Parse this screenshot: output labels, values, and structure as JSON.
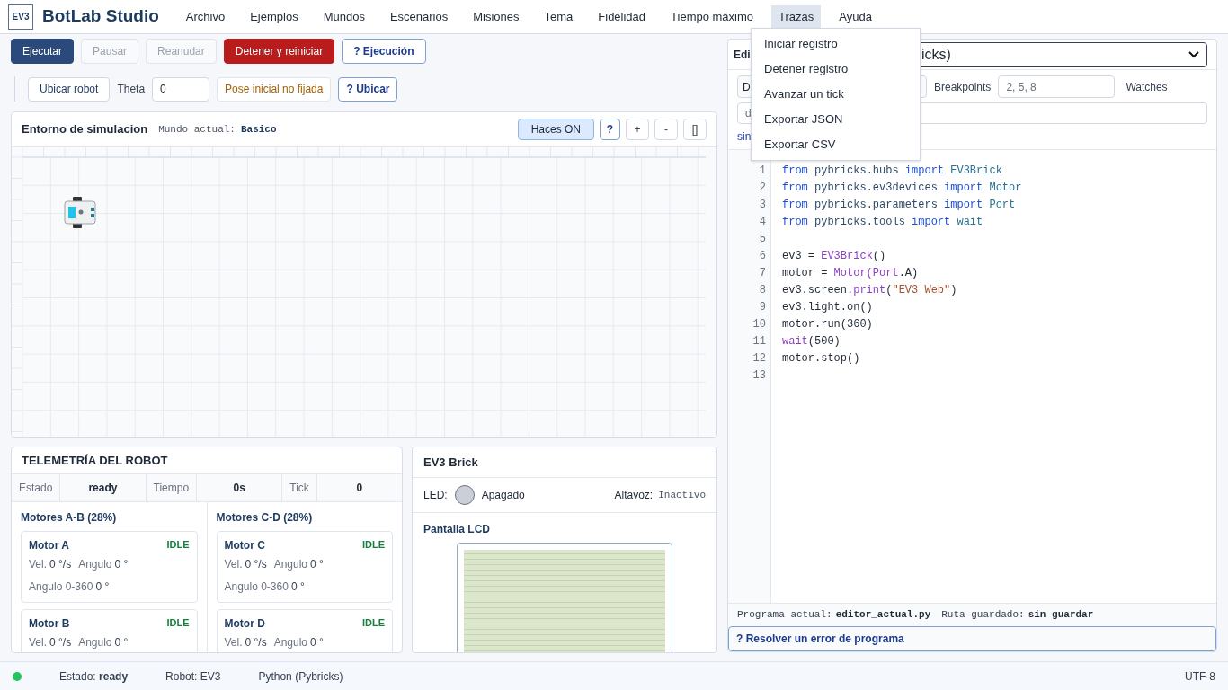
{
  "app": {
    "logo": "EV3",
    "title": "BotLab Studio"
  },
  "menu_bar": [
    {
      "label": "Archivo",
      "selected": false
    },
    {
      "label": "Ejemplos",
      "selected": false
    },
    {
      "label": "Mundos",
      "selected": false
    },
    {
      "label": "Escenarios",
      "selected": false
    },
    {
      "label": "Misiones",
      "selected": false
    },
    {
      "label": "Tema",
      "selected": false
    },
    {
      "label": "Fidelidad",
      "selected": false
    },
    {
      "label": "Tiempo máximo",
      "selected": false
    },
    {
      "label": "Trazas",
      "selected": true
    },
    {
      "label": "Ayuda",
      "selected": false
    }
  ],
  "open_menu": {
    "items": [
      "Iniciar registro",
      "Detener registro",
      "Avanzar un tick",
      "Exportar JSON",
      "Exportar CSV"
    ]
  },
  "run_toolbar": [
    {
      "label": "Ejecutar",
      "kind": "primary"
    },
    {
      "label": "Pausar",
      "kind": "disabled"
    },
    {
      "label": "Reanudar",
      "kind": "disabled"
    },
    {
      "label": "Detener y reiniciar",
      "kind": "danger"
    },
    {
      "label": "? Ejecución",
      "kind": "help"
    }
  ],
  "place_toolbar": {
    "place_button": "Ubicar robot",
    "theta_label": "Theta",
    "theta_value": "0",
    "pose_status": "Pose inicial no fijada",
    "help_button": "? Ubicar"
  },
  "simulation": {
    "title": "Entorno de simulacion",
    "world_label": "Mundo actual:",
    "world": "Basico",
    "controls": [
      {
        "label": "Haces ON",
        "kind": "toggle",
        "on": true
      },
      {
        "label": "?",
        "kind": "help"
      },
      {
        "label": "+",
        "kind": "plain"
      },
      {
        "label": "-",
        "kind": "plain"
      },
      {
        "label": "[]",
        "kind": "plain"
      }
    ]
  },
  "telemetry": {
    "title": "TELEMETRÍA DEL ROBOT",
    "stats": [
      {
        "label": "Estado",
        "value": "ready"
      },
      {
        "label": "Tiempo",
        "value": "0s"
      },
      {
        "label": "Tick",
        "value": "0"
      }
    ],
    "groups": [
      {
        "title": "Motores A-B (28%)",
        "motors": [
          {
            "name": "Motor A",
            "status": "IDLE",
            "rows": [
              [
                {
                  "label": "Vel.",
                  "value": "0 °/s"
                },
                {
                  "label": "Angulo",
                  "value": "0 °"
                }
              ],
              [
                {
                  "label": "Angulo 0-360",
                  "value": "0 °"
                }
              ]
            ]
          },
          {
            "name": "Motor B",
            "status": "IDLE",
            "rows": [
              [
                {
                  "label": "Vel.",
                  "value": "0 °/s"
                },
                {
                  "label": "Angulo",
                  "value": "0 °"
                }
              ]
            ]
          }
        ]
      },
      {
        "title": "Motores C-D (28%)",
        "motors": [
          {
            "name": "Motor C",
            "status": "IDLE",
            "rows": [
              [
                {
                  "label": "Vel.",
                  "value": "0 °/s"
                },
                {
                  "label": "Angulo",
                  "value": "0 °"
                }
              ],
              [
                {
                  "label": "Angulo 0-360",
                  "value": "0 °"
                }
              ]
            ]
          },
          {
            "name": "Motor D",
            "status": "IDLE",
            "rows": [
              [
                {
                  "label": "Vel.",
                  "value": "0 °/s"
                },
                {
                  "label": "Angulo",
                  "value": "0 °"
                }
              ]
            ]
          }
        ]
      }
    ]
  },
  "brick": {
    "title": "EV3 Brick",
    "led_label": "LED:",
    "led_on": false,
    "led_state": "Apagado",
    "speaker_label": "Altavoz:",
    "speaker_state": "Inactivo",
    "lcd_title": "Pantalla LCD"
  },
  "editor": {
    "title": "Edi",
    "language_select": "icks)",
    "debug_button": "D",
    "breakpoints_label": "Breakpoints",
    "breakpoints_value": "2, 5, 8",
    "watches_label": "Watches",
    "watch_value": "d",
    "note": "sin",
    "code": [
      {
        "number": "1",
        "tokens": [
          {
            "kind": "kw",
            "text": "from "
          },
          {
            "kind": "mod",
            "text": "pybricks.hubs "
          },
          {
            "kind": "kw",
            "text": "import "
          },
          {
            "kind": "name",
            "text": "EV3Brick"
          }
        ]
      },
      {
        "number": "2",
        "tokens": [
          {
            "kind": "kw",
            "text": "from "
          },
          {
            "kind": "mod",
            "text": "pybricks.ev3devices "
          },
          {
            "kind": "kw",
            "text": "import "
          },
          {
            "kind": "name",
            "text": "Motor"
          }
        ]
      },
      {
        "number": "3",
        "tokens": [
          {
            "kind": "kw",
            "text": "from "
          },
          {
            "kind": "mod",
            "text": "pybricks.parameters "
          },
          {
            "kind": "kw",
            "text": "import "
          },
          {
            "kind": "name",
            "text": "Port"
          }
        ]
      },
      {
        "number": "4",
        "tokens": [
          {
            "kind": "kw",
            "text": "from "
          },
          {
            "kind": "mod",
            "text": "pybricks.tools "
          },
          {
            "kind": "kw",
            "text": "import "
          },
          {
            "kind": "name",
            "text": "wait"
          }
        ]
      },
      {
        "number": "5"
      },
      {
        "number": "6",
        "tokens": [
          {
            "kind": "plain",
            "text": "ev3 = "
          },
          {
            "kind": "call",
            "text": "EV3Brick"
          },
          {
            "kind": "plain",
            "text": "()"
          }
        ]
      },
      {
        "number": "7",
        "tokens": [
          {
            "kind": "plain",
            "text": "motor = "
          },
          {
            "kind": "call",
            "text": "Motor(Port"
          },
          {
            "kind": "plain",
            "text": ".A)"
          }
        ]
      },
      {
        "number": "8",
        "tokens": [
          {
            "kind": "plain",
            "text": "ev3.screen."
          },
          {
            "kind": "call",
            "text": "print"
          },
          {
            "kind": "plain",
            "text": "("
          },
          {
            "kind": "str",
            "text": "\"EV3 Web\""
          },
          {
            "kind": "plain",
            "text": ")"
          }
        ]
      },
      {
        "number": "9",
        "tokens": [
          {
            "kind": "plain",
            "text": "ev3.light.on()"
          }
        ]
      },
      {
        "number": "10",
        "tokens": [
          {
            "kind": "plain",
            "text": "motor.run(360)"
          }
        ]
      },
      {
        "number": "11",
        "tokens": [
          {
            "kind": "call",
            "text": "wait"
          },
          {
            "kind": "plain",
            "text": "(500)"
          }
        ]
      },
      {
        "number": "12",
        "tokens": [
          {
            "kind": "plain",
            "text": "motor.stop()"
          }
        ]
      },
      {
        "number": "13"
      }
    ],
    "program_label": "Programa actual:",
    "program": "editor_actual.py",
    "path_label": "Ruta guardado:",
    "path": "sin guardar",
    "help_button": "? Resolver un error de programa"
  },
  "status_bar": {
    "online": true,
    "state_label": "Estado:",
    "state": "ready",
    "robot": "Robot: EV3",
    "language": "Python (Pybricks)",
    "encoding": "UTF-8"
  }
}
